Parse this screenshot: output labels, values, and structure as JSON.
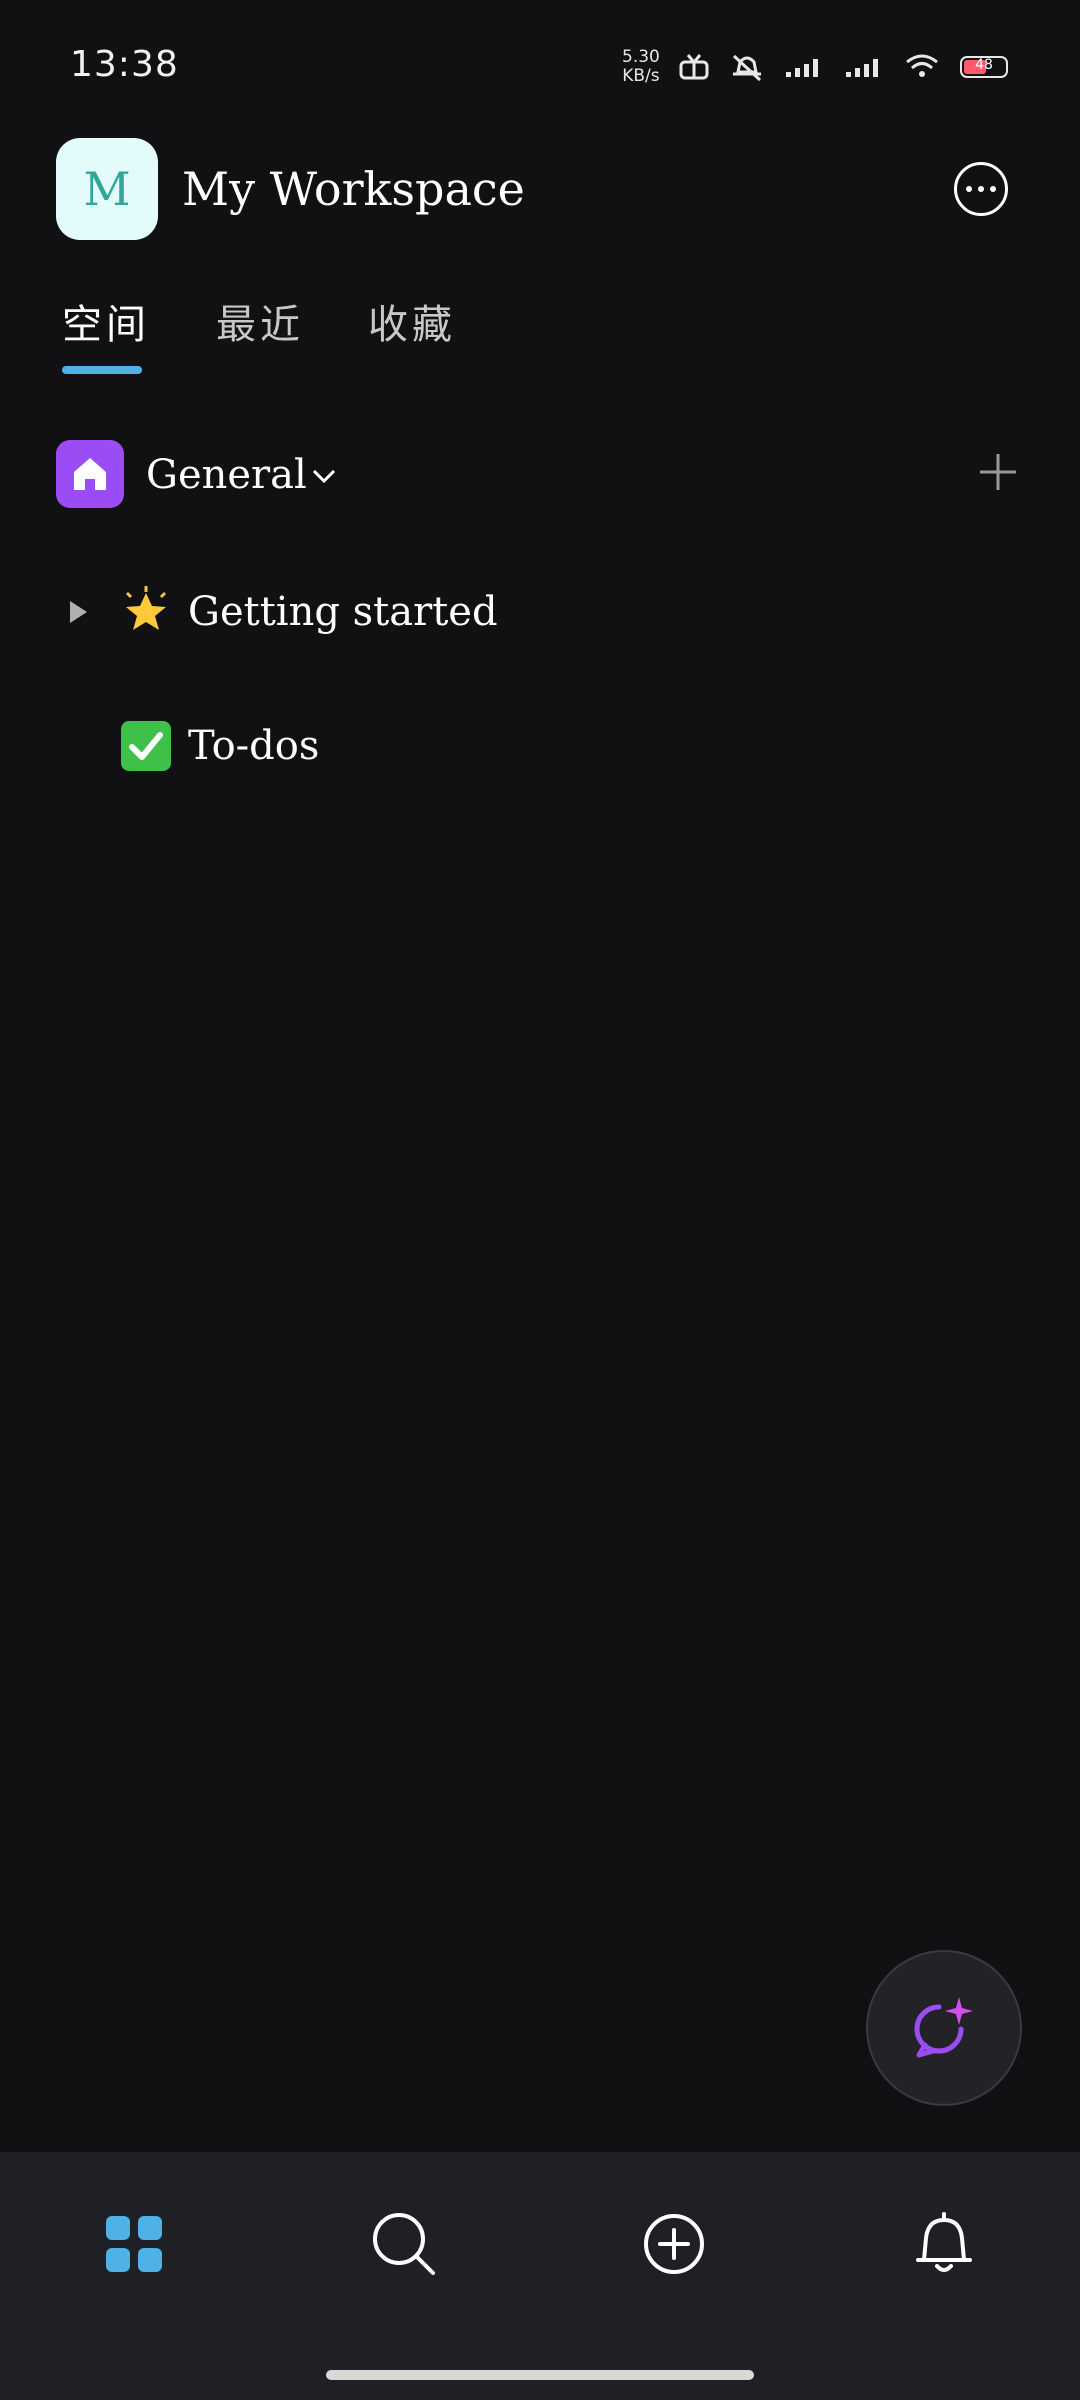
{
  "status_bar": {
    "time": "13:38",
    "net_speed_value": "5.30",
    "net_speed_unit": "KB/s",
    "battery_level": "48"
  },
  "header": {
    "avatar_letter": "M",
    "workspace_name": "My Workspace",
    "more_icon": "more-horizontal-icon"
  },
  "tabs": [
    {
      "label": "空间",
      "active": true
    },
    {
      "label": "最近",
      "active": false
    },
    {
      "label": "收藏",
      "active": false
    }
  ],
  "space": {
    "name": "General",
    "icon": "home-icon",
    "icon_color": "#9b4df5"
  },
  "pages": [
    {
      "emoji": "star-icon",
      "title": "Getting started",
      "expandable": true
    },
    {
      "emoji": "check-box-icon",
      "title": "To-dos",
      "expandable": false
    }
  ],
  "bottom_nav": [
    {
      "name": "home",
      "icon": "grid-icon",
      "active": true
    },
    {
      "name": "search",
      "icon": "search-icon",
      "active": false
    },
    {
      "name": "add",
      "icon": "plus-circle-icon",
      "active": false
    },
    {
      "name": "notifications",
      "icon": "bell-icon",
      "active": false
    }
  ],
  "colors": {
    "background": "#111113",
    "accent": "#4fb2e6",
    "nav_background": "#1f2025"
  }
}
